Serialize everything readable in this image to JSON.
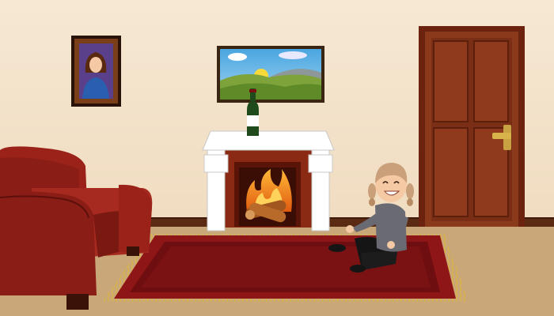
{
  "scene": {
    "room": "living-room",
    "wall_color": "#f4e4cc",
    "floor_color": "#c9a779",
    "baseboard_color": "#5a2a12",
    "wall_art": {
      "portrait": "portrait-of-woman",
      "landscape": "landscape-with-hills-and-sun"
    },
    "furniture": [
      "red-armchair",
      "white-fireplace",
      "wooden-door",
      "red-rug"
    ],
    "objects": [
      "wine-bottle",
      "burning-logs"
    ],
    "character": "girl-with-pigtails-sitting-on-floor",
    "colors": {
      "sofa": "#8a1d16",
      "rug": "#8f1616",
      "rug_fringe": "#d8b24a",
      "door": "#7a2e15",
      "fireplace": "#ffffff",
      "fire": "#f08a1a"
    }
  }
}
